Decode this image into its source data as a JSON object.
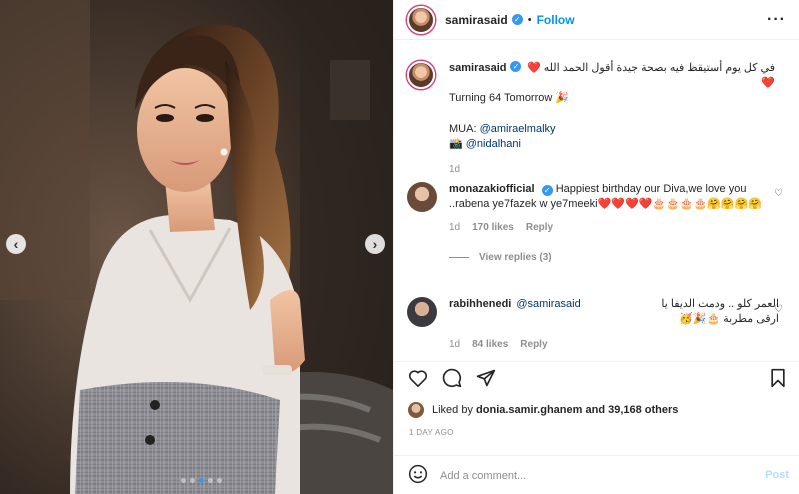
{
  "post": {
    "author": "samirasaid",
    "verified": true,
    "follow_label": "Follow",
    "separator": "•",
    "more_icon": "more-horizontal-icon"
  },
  "caption": {
    "username": "samirasaid",
    "line1": "في كل يوم أستيقظ فيه بصحة جيدة أقول الحمد الله ❤️❤️",
    "line2": "Turning 64 Tomorrow 🎉",
    "mua_label": "MUA:",
    "mua_handle": "@amiraelmalky",
    "camera_emoji": "📸",
    "photo_handle": "@nidalhani",
    "time": "1d"
  },
  "comments": [
    {
      "username": "monazakiofficial",
      "verified": true,
      "text": "Happiest birthday our Diva,we love you ..rabena ye7fazek w ye7meeki❤️❤️❤️❤️🎂🎂🎂🎂🤗🤗🤗🤗",
      "time": "1d",
      "likes": "170 likes",
      "reply": "Reply",
      "view_replies": "View replies (3)"
    },
    {
      "username": "rabihhenedi",
      "verified": false,
      "mention": "@samirasaid",
      "text": "العمر كلو .. ودمت الديفا يا ارقى مطربة 🎂🎉🥳",
      "time": "1d",
      "likes": "84 likes",
      "reply": "Reply"
    }
  ],
  "actions": {
    "liked_by_prefix": "Liked by",
    "liked_by_user": "donia.samir.ghanem",
    "liked_by_suffix": "and 39,168 others",
    "timestamp": "1 DAY AGO"
  },
  "add_comment": {
    "placeholder": "Add a comment...",
    "post_label": "Post",
    "emoji_icon": "smiley-icon"
  },
  "carousel": {
    "prev": "‹",
    "next": "›",
    "dots": 5,
    "active_dot": 3
  },
  "colors": {
    "accent": "#0095f6",
    "verified": "#3897f0",
    "muted": "#8e8e8e",
    "post_disabled": "#b2dffc"
  }
}
